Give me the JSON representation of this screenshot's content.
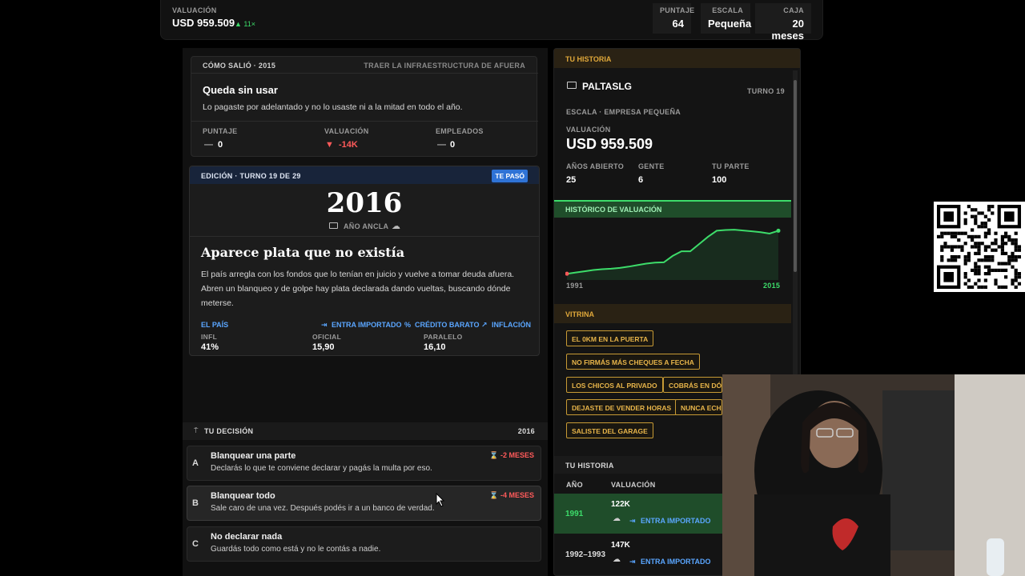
{
  "topbar": {
    "valuation_label": "VALUACIÓN",
    "valuation_value": "USD 959.509",
    "valuation_change": "▲ 11×",
    "stats": [
      {
        "label": "PUNTAJE",
        "value": "64"
      },
      {
        "label": "ESCALA",
        "value": "Pequeña"
      },
      {
        "label": "CAJA",
        "value": "20 meses"
      }
    ]
  },
  "outcome": {
    "header_left": "CÓMO SALIÓ · 2015",
    "header_right": "TRAER LA INFRAESTRUCTURA DE AFUERA",
    "title": "Queda sin usar",
    "desc": "Lo pagaste por adelantado y no lo usaste ni a la mitad en todo el año.",
    "metrics": [
      {
        "label": "PUNTAJE",
        "symbol": "—",
        "value": "0"
      },
      {
        "label": "VALUACIÓN",
        "symbol": "▼",
        "value": "-14K"
      },
      {
        "label": "EMPLEADOS",
        "symbol": "—",
        "value": "0"
      }
    ]
  },
  "edition": {
    "header": "EDICIÓN · TURNO 19 DE 29",
    "badge": "TE PASÓ",
    "year": "2016",
    "anchor": "AÑO ANCLA",
    "title": "Aparece plata que no existía",
    "body": "El país arregla con los fondos que lo tenían en juicio y vuelve a tomar deuda afuera. Abren un blanqueo y de golpe hay plata declarada dando vueltas, buscando dónde meterse.",
    "country_label": "EL PAÍS",
    "tags": [
      "ENTRA IMPORTADO",
      "CRÉDITO BARATO",
      "INFLACIÓN"
    ],
    "stats": [
      {
        "label": "INFL",
        "value": "41%"
      },
      {
        "label": "OFICIAL",
        "value": "15,90"
      },
      {
        "label": "PARALELO",
        "value": "16,10"
      }
    ]
  },
  "decision": {
    "header": "TU DECISIÓN",
    "year": "2016",
    "options": [
      {
        "letter": "A",
        "title": "Blanquear una parte",
        "desc": "Declarás lo que te conviene declarar y pagás la multa por eso.",
        "cost": "⌛ -2 MESES"
      },
      {
        "letter": "B",
        "title": "Blanquear todo",
        "desc": "Sale caro de una vez. Después podés ir a un banco de verdad.",
        "cost": "⌛ -4 MESES"
      },
      {
        "letter": "C",
        "title": "No declarar nada",
        "desc": "Guardás todo como está y no le contás a nadie.",
        "cost": ""
      }
    ]
  },
  "history": {
    "header": "TU HISTORIA",
    "company": "PALTASLG",
    "turn": "TURNO 19",
    "scale": "ESCALA · EMPRESA PEQUEÑA",
    "valuation_label": "VALUACIÓN",
    "valuation": "USD 959.509",
    "facts": [
      {
        "label": "AÑOS ABIERTO",
        "value": "25"
      },
      {
        "label": "GENTE",
        "value": "6"
      },
      {
        "label": "TU PARTE",
        "value": "100"
      }
    ],
    "chart_header": "HISTÓRICO DE VALUACIÓN",
    "chart_start": "1991",
    "chart_end": "2015",
    "vitrina_header": "VITRINA",
    "vitrina": [
      "EL 0KM EN LA PUERTA",
      "NO FIRMÁS MÁS CHEQUES A FECHA",
      "LOS CHICOS AL PRIVADO",
      "COBRÁS EN DÓL",
      "DEJASTE DE VENDER HORAS",
      "NUNCA ECHA",
      "SALISTE DEL GARAGE"
    ],
    "table_header": "TU HISTORIA",
    "table_cols": [
      "AÑO",
      "VALUACIÓN"
    ],
    "rows": [
      {
        "year": "1991",
        "val": "122K",
        "tag": "ENTRA IMPORTADO"
      },
      {
        "year": "1992–1993",
        "val": "147K",
        "tag": "ENTRA IMPORTADO"
      }
    ]
  },
  "chart_data": {
    "type": "area",
    "x": [
      1991,
      1992,
      1993,
      1994,
      1995,
      1996,
      1997,
      1998,
      1999,
      2000,
      2001,
      2002,
      2003,
      2004,
      2005,
      2006,
      2007,
      2008,
      2009,
      2010,
      2011,
      2012,
      2013,
      2014,
      2015
    ],
    "values": [
      122,
      147,
      170,
      195,
      210,
      220,
      235,
      260,
      290,
      320,
      340,
      345,
      470,
      560,
      560,
      700,
      840,
      960,
      975,
      980,
      965,
      950,
      930,
      905,
      960
    ],
    "xlabel": "",
    "ylabel": ""
  },
  "colors": {
    "accent_green": "#3ddc6a",
    "gold": "#e0a83a",
    "blue": "#5aa6ff",
    "red": "#ff5a5a"
  }
}
